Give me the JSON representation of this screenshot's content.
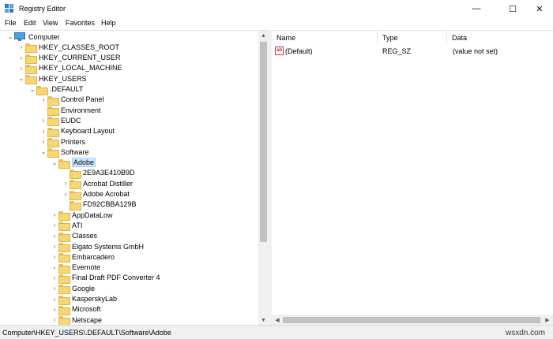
{
  "window": {
    "title": "Registry Editor",
    "minimize_glyph": "—",
    "maximize_glyph": "☐",
    "close_glyph": "✕"
  },
  "menu": [
    "File",
    "Edit",
    "View",
    "Favorites",
    "Help"
  ],
  "tree": [
    {
      "label": "Computer",
      "depth": 0,
      "state": "expanded",
      "icon": "computer-icon"
    },
    {
      "label": "HKEY_CLASSES_ROOT",
      "depth": 1,
      "state": "collapsed",
      "icon": "folder-icon"
    },
    {
      "label": "HKEY_CURRENT_USER",
      "depth": 1,
      "state": "collapsed",
      "icon": "folder-icon"
    },
    {
      "label": "HKEY_LOCAL_MACHINE",
      "depth": 1,
      "state": "collapsed",
      "icon": "folder-icon"
    },
    {
      "label": "HKEY_USERS",
      "depth": 1,
      "state": "expanded",
      "icon": "folder-icon"
    },
    {
      "label": ".DEFAULT",
      "depth": 2,
      "state": "expanded",
      "icon": "folder-icon"
    },
    {
      "label": "Control Panel",
      "depth": 3,
      "state": "collapsed",
      "icon": "folder-icon"
    },
    {
      "label": "Environment",
      "depth": 3,
      "state": "none",
      "icon": "folder-icon"
    },
    {
      "label": "EUDC",
      "depth": 3,
      "state": "collapsed",
      "icon": "folder-icon"
    },
    {
      "label": "Keyboard Layout",
      "depth": 3,
      "state": "collapsed",
      "icon": "folder-icon"
    },
    {
      "label": "Printers",
      "depth": 3,
      "state": "collapsed",
      "icon": "folder-icon"
    },
    {
      "label": "Software",
      "depth": 3,
      "state": "expanded",
      "icon": "folder-icon"
    },
    {
      "label": "Adobe",
      "depth": 4,
      "state": "expanded",
      "icon": "folder-icon",
      "selected": true
    },
    {
      "label": "2E9A3E410B9D",
      "depth": 5,
      "state": "none",
      "icon": "folder-icon"
    },
    {
      "label": "Acrobat Distiller",
      "depth": 5,
      "state": "collapsed",
      "icon": "folder-icon"
    },
    {
      "label": "Adobe Acrobat",
      "depth": 5,
      "state": "collapsed",
      "icon": "folder-icon"
    },
    {
      "label": "FD92CBBA129B",
      "depth": 5,
      "state": "none",
      "icon": "folder-icon"
    },
    {
      "label": "AppDataLow",
      "depth": 4,
      "state": "collapsed",
      "icon": "folder-icon"
    },
    {
      "label": "ATI",
      "depth": 4,
      "state": "collapsed",
      "icon": "folder-icon"
    },
    {
      "label": "Classes",
      "depth": 4,
      "state": "collapsed",
      "icon": "folder-icon"
    },
    {
      "label": "Elgato Systems GmbH",
      "depth": 4,
      "state": "collapsed",
      "icon": "folder-icon"
    },
    {
      "label": "Embarcadero",
      "depth": 4,
      "state": "collapsed",
      "icon": "folder-icon"
    },
    {
      "label": "Evernote",
      "depth": 4,
      "state": "collapsed",
      "icon": "folder-icon"
    },
    {
      "label": "Final Draft PDF Converter 4",
      "depth": 4,
      "state": "collapsed",
      "icon": "folder-icon"
    },
    {
      "label": "Google",
      "depth": 4,
      "state": "collapsed",
      "icon": "folder-icon"
    },
    {
      "label": "KasperskyLab",
      "depth": 4,
      "state": "collapsed",
      "icon": "folder-icon"
    },
    {
      "label": "Microsoft",
      "depth": 4,
      "state": "collapsed",
      "icon": "folder-icon"
    },
    {
      "label": "Netscape",
      "depth": 4,
      "state": "collapsed",
      "icon": "folder-icon"
    }
  ],
  "values_list": {
    "columns": [
      "Name",
      "Type",
      "Data"
    ],
    "rows": [
      {
        "name": "(Default)",
        "type": "REG_SZ",
        "data": "(value not set)",
        "icon": "string-value-icon",
        "icon_text": "ab"
      }
    ]
  },
  "status": {
    "path": "Computer\\HKEY_USERS\\.DEFAULT\\Software\\Adobe",
    "watermark": "wsxdn.com"
  },
  "colors": {
    "selection": "#cce8ff",
    "folder": "#f7d774",
    "scroll_thumb": "#c1c1c1"
  }
}
